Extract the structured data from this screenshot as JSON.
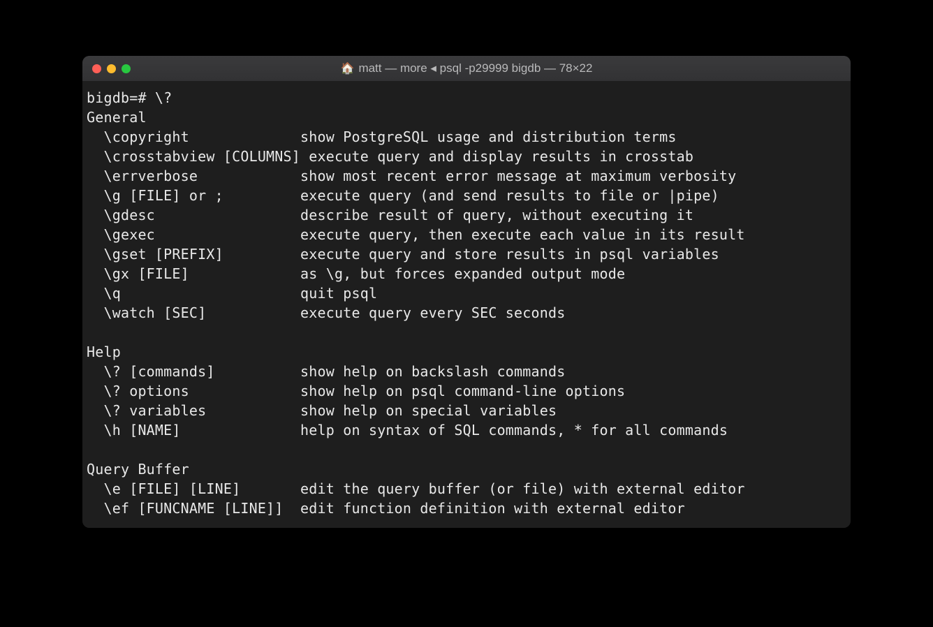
{
  "window": {
    "title": "matt — more ◂ psql -p29999 bigdb — 78×22",
    "home_icon": "🏠"
  },
  "terminal": {
    "lines": [
      "bigdb=# \\?",
      "General",
      "  \\copyright             show PostgreSQL usage and distribution terms",
      "  \\crosstabview [COLUMNS] execute query and display results in crosstab",
      "  \\errverbose            show most recent error message at maximum verbosity",
      "  \\g [FILE] or ;         execute query (and send results to file or |pipe)",
      "  \\gdesc                 describe result of query, without executing it",
      "  \\gexec                 execute query, then execute each value in its result",
      "  \\gset [PREFIX]         execute query and store results in psql variables",
      "  \\gx [FILE]             as \\g, but forces expanded output mode",
      "  \\q                     quit psql",
      "  \\watch [SEC]           execute query every SEC seconds",
      "",
      "Help",
      "  \\? [commands]          show help on backslash commands",
      "  \\? options             show help on psql command-line options",
      "  \\? variables           show help on special variables",
      "  \\h [NAME]              help on syntax of SQL commands, * for all commands",
      "",
      "Query Buffer",
      "  \\e [FILE] [LINE]       edit the query buffer (or file) with external editor",
      "  \\ef [FUNCNAME [LINE]]  edit function definition with external editor"
    ]
  }
}
